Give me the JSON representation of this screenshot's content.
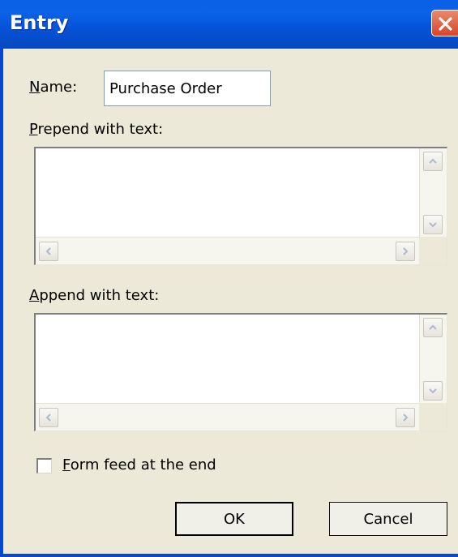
{
  "window": {
    "title": "Entry"
  },
  "colors": {
    "titlebar": "#0b5ee5",
    "close": "#d8432a",
    "dialog_bg": "#ece9d8"
  },
  "name": {
    "label_key": "N",
    "label_rest": "ame:",
    "value": "Purchase Order"
  },
  "prepend": {
    "label_key": "P",
    "label_rest": "repend with text:",
    "value": ""
  },
  "append": {
    "label_key": "A",
    "label_rest": "ppend with text:",
    "value": ""
  },
  "form_feed": {
    "label_key": "F",
    "label_rest": "orm feed at the end",
    "checked": false
  },
  "buttons": {
    "ok": "OK",
    "cancel": "Cancel"
  },
  "icons": {
    "close": "close-icon",
    "scroll_up": "chevron-up-icon",
    "scroll_down": "chevron-down-icon",
    "scroll_left": "chevron-left-icon",
    "scroll_right": "chevron-right-icon"
  }
}
